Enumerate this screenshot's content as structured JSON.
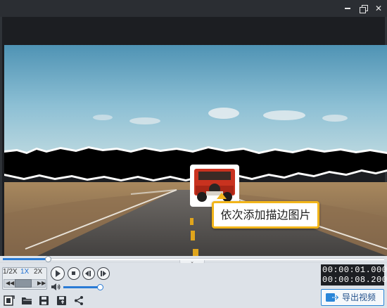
{
  "titlebar": {
    "minimize_icon": "minimize-icon",
    "restore_icon": "restore-icon",
    "close_icon": "close-icon",
    "close_glyph": "✕"
  },
  "preview": {
    "caption_text": "依次添加描边图片"
  },
  "playback": {
    "progress": 0.12,
    "speed_options": [
      "1/2X",
      "1X",
      "2X"
    ],
    "selected_speed": "1X",
    "speed_decrease": "◀◀",
    "speed_increase": "▶▶",
    "volume": 0.92,
    "current_time": "00:00:01.000",
    "total_time": "00:00:08.200"
  },
  "bottom_toolbar": {
    "export_label": "导出视频"
  },
  "colors": {
    "accent": "#2a7bd5",
    "caption_border": "#f2b51a",
    "titlebar": "#2b2e33"
  }
}
